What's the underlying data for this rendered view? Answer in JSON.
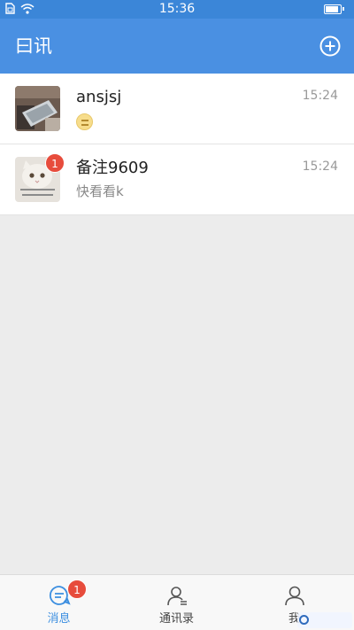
{
  "status_bar": {
    "time": "15:36",
    "battery_level": 0.9,
    "icons": [
      "sim-icon",
      "wifi-icon",
      "battery-icon"
    ]
  },
  "header": {
    "title": "曰讯",
    "add_icon": "plus-circle-icon"
  },
  "chats": [
    {
      "name": "ansjsj",
      "preview_icon": "emoji-icon",
      "time": "15:24",
      "unread": null
    },
    {
      "name": "备注9609",
      "preview": "快看看k",
      "time": "15:24",
      "unread": "1"
    }
  ],
  "tabs": [
    {
      "label": "消息",
      "icon": "message-icon",
      "badge": "1",
      "active": true
    },
    {
      "label": "通讯录",
      "icon": "contacts-icon",
      "active": false
    },
    {
      "label": "我",
      "icon": "profile-icon",
      "active": false
    }
  ],
  "colors": {
    "status_bar": "#3b86d8",
    "header": "#4a90e2",
    "accent": "#3b8ee0",
    "badge": "#e74c3c"
  }
}
